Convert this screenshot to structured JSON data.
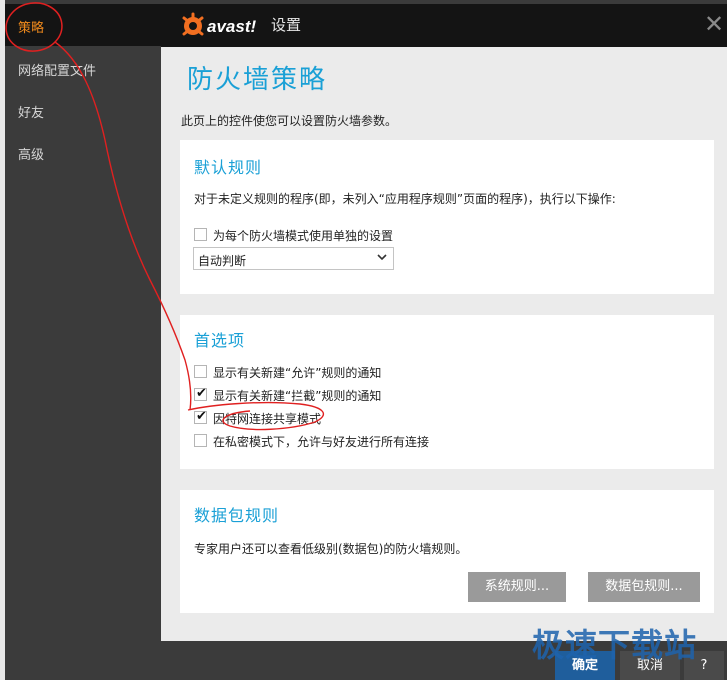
{
  "sidebar": {
    "items": [
      {
        "label": "策略",
        "active": true
      },
      {
        "label": "网络配置文件",
        "active": false
      },
      {
        "label": "好友",
        "active": false
      },
      {
        "label": "高级",
        "active": false
      }
    ]
  },
  "titlebar": {
    "brand": "avast!",
    "title": "设置",
    "close_icon": "close-x-icon"
  },
  "page": {
    "title": "防火墙策略",
    "description": "此页上的控件使您可以设置防火墙参数。"
  },
  "default_rules": {
    "title": "默认规则",
    "description": "对于未定义规则的程序(即，未列入“应用程序规则”页面的程序)，执行以下操作:",
    "separate_setting": {
      "label": "为每个防火墙模式使用单独的设置",
      "checked": false
    },
    "action_select": {
      "value": "自动判断"
    }
  },
  "preferences": {
    "title": "首选项",
    "options": [
      {
        "label": "显示有关新建“允许”规则的通知",
        "checked": false
      },
      {
        "label": "显示有关新建“拦截”规则的通知",
        "checked": true
      },
      {
        "label": "因特网连接共享模式",
        "checked": true
      },
      {
        "label": "在私密模式下，允许与好友进行所有连接",
        "checked": false
      }
    ]
  },
  "packet_rules": {
    "title": "数据包规则",
    "description": "专家用户还可以查看低级别(数据包)的防火墙规则。",
    "system_rules_button": "系统规则...",
    "packet_rules_button": "数据包规则..."
  },
  "footer": {
    "ok": "确定",
    "cancel": "取消",
    "help": "?"
  },
  "watermark": "极速下载站",
  "colors": {
    "accent": "#1aa0d6",
    "active_nav": "#f08a1c",
    "brand_orange": "#f26f21",
    "footer_blue": "#1f5e9c",
    "annotation_red": "#e02020"
  }
}
